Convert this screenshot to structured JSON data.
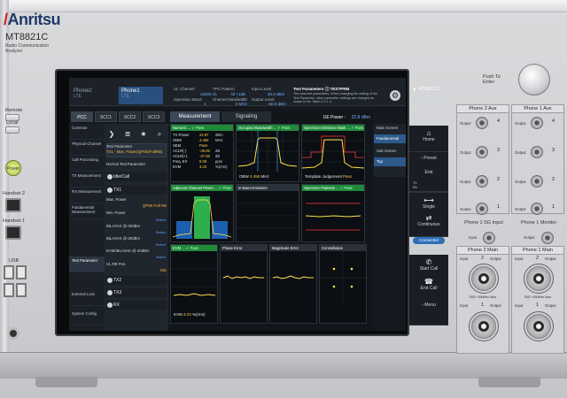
{
  "device": {
    "brand": "Anritsu",
    "model": "MT8821C",
    "description": "Radio Communication Analyzer"
  },
  "left_panel": {
    "remote_label": "Remote",
    "local_label": "Local",
    "power_label": "Power",
    "handset2_label": "Handset 2",
    "handset1_label": "Handset 1",
    "usb_label": "USB"
  },
  "status_bar": {
    "phone_tabs": [
      {
        "label": "Phone2",
        "sub": "LTE"
      },
      {
        "label": "Phone1",
        "sub": "LTE"
      }
    ],
    "fields": [
      {
        "label": "UL Channel",
        "value": "18300 ch"
      },
      {
        "label": "TPC Pattern",
        "value": "All +1dB"
      },
      {
        "label": "Input Level",
        "value": "30.0 dBm"
      },
      {
        "label": "Operation Band",
        "value": "1"
      },
      {
        "label": "Channel Bandwidth",
        "value": "5 MHz"
      },
      {
        "label": "Output Level",
        "value": "-50.0 dBm"
      }
    ],
    "test_param_title": "Test Parameters ⓘ TESTPRM",
    "test_param_desc": "This sets test parameters. When changing the setting of the Test Parameter, other parameter settings are changed as shown in the Table 2.X.2.-1."
  },
  "carrier_tabs": [
    "PCC",
    "SCC1",
    "SCC2",
    "SCC3"
  ],
  "left_nav": [
    "Common",
    "Physical Channel",
    "Call Processing",
    "TX Measurement",
    "RX Measurement",
    "Fundamental Measurement",
    "Test Parameter",
    "External Loss",
    "System Config"
  ],
  "param_panel": {
    "test_parameter_label": "Test Parameter",
    "test_parameter_value": "TX1 - Max. Power(QPSK/FullRB)",
    "normal_label": "Normal Test Parameter",
    "idle_call": "Idle/Call",
    "tx1": "TX1",
    "max_power_label": "Max. Power",
    "max_power_value": "QPSK Full RB",
    "min_power_label": "Min. Power",
    "select_label": "Select",
    "ibias1": "IBLA/IAK @-30dBm",
    "ibias2": "IBLA/IAK @-30dBm",
    "evm_label": "EVM/IBLA/IAK @-40dBm",
    "ulrb_label": "UL RB Pos.",
    "ulrb_value": "Min",
    "tx2": "TX2",
    "tx3": "TX3",
    "rx": "RX"
  },
  "main": {
    "tabs": [
      "Measurement",
      "Signaling"
    ],
    "ue_power_label": "UE Power :",
    "ue_power_value": "22.8 dBm"
  },
  "panes": {
    "numeric": {
      "title": "Numeric ...",
      "status": "Pass",
      "rows": [
        {
          "label": "TX Power",
          "value": "22.87",
          "unit": "dBm"
        },
        {
          "label": "OBW",
          "value": "4.455",
          "unit": "MHz"
        },
        {
          "label": "SEM",
          "value": "Pass",
          "unit": ""
        },
        {
          "label": "ACLR(-)",
          "value": "-39.06",
          "unit": "dB"
        },
        {
          "label": "ACLR(+)",
          "value": "-37.59",
          "unit": "dB"
        },
        {
          "label": "Freq. Err",
          "value": "0.09",
          "unit": "ppm"
        },
        {
          "label": "EVM",
          "value": "3.23",
          "unit": "%(rms)"
        }
      ]
    },
    "obw": {
      "title": "Occupied Bandwidth ...",
      "status": "Pass",
      "footer_label": "OBW",
      "footer_value": "4.455",
      "footer_unit": "MHz"
    },
    "sem": {
      "title": "Spectrum Emission Mask ...",
      "status": "Pass",
      "footer_label": "Template Judgement",
      "footer_value": "Pass"
    },
    "acp": {
      "title": "Adjacent Channel Power ...",
      "status": "Pass"
    },
    "ibe": {
      "title": "In-Band Emission"
    },
    "flat": {
      "title": "Spectrum Flatness ...",
      "status": "Pass"
    },
    "evm": {
      "title": "EVM ...",
      "status": "Pass",
      "footer_label": "EVM",
      "footer_value": "3.23",
      "footer_unit": "%(rms)"
    },
    "phase": {
      "title": "Phase Error"
    },
    "mag": {
      "title": "Magnitude Error"
    },
    "const": {
      "title": "Constellation"
    }
  },
  "right_main": {
    "items": [
      "Main Screen",
      "Fundamental",
      "Sub Screen",
      "Top"
    ]
  },
  "softkeys": {
    "title": "MT8821C",
    "output_label": "W Output : On",
    "home": "Home",
    "preset": "Preset",
    "end": "End",
    "tx": "Tx",
    "rx": "Rx",
    "single": "Single",
    "continuous": "Continuous",
    "connected": "Connected",
    "start_call": "Start Call",
    "end_call": "End Call",
    "menu": "Menu"
  },
  "right_side": {
    "push_to_enter": "Push To Enter",
    "phone2_aux": "Phone 2 Aux",
    "phone1_aux": "Phone 1 Aux",
    "output_label": "Output",
    "input_label": "Input",
    "phone1_sg_input": "Phone 1 SG Input",
    "phone1_monitor": "Phone 1 Monitor",
    "phone2_main": "Phone 2 Main",
    "phone1_main": "Phone 1 Main",
    "main_spec": "50Ω +35dBm Max",
    "ports": [
      "4",
      "3",
      "2",
      "1"
    ]
  }
}
